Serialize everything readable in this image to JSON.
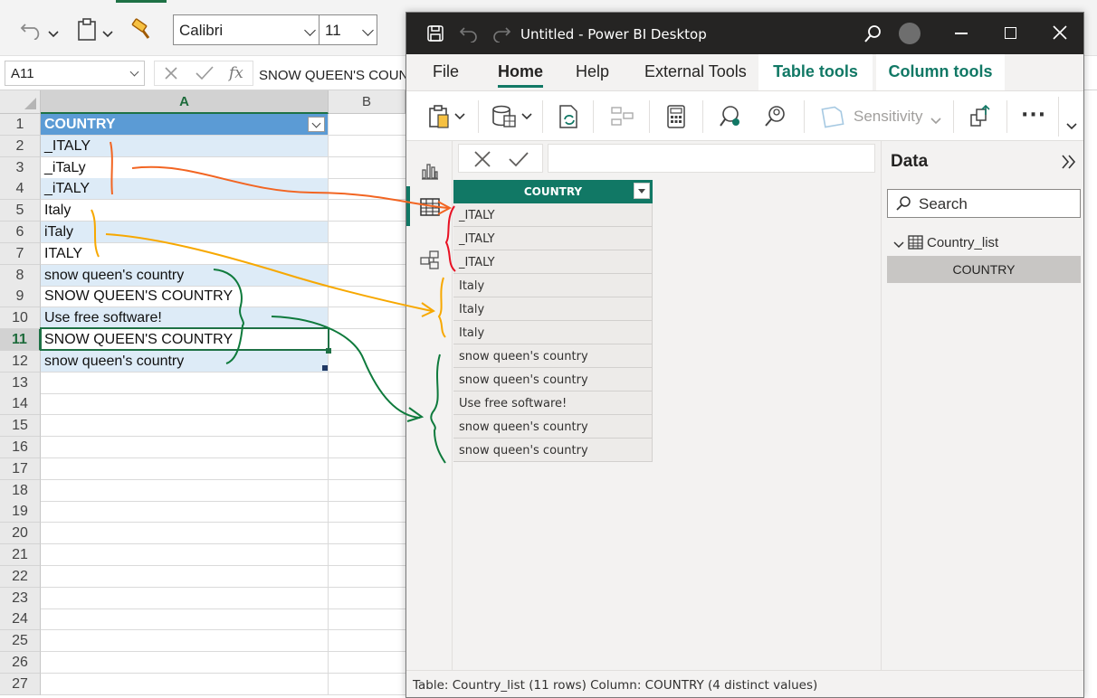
{
  "excel": {
    "font_name": "Calibri",
    "font_size": "11",
    "name_box": "A11",
    "formula": "SNOW QUEEN'S COUNTRY",
    "col_headers": [
      "A",
      "B"
    ],
    "row_numbers": [
      "1",
      "2",
      "3",
      "4",
      "5",
      "6",
      "7",
      "8",
      "9",
      "10",
      "11",
      "12",
      "13",
      "14",
      "15",
      "16",
      "17",
      "18",
      "19",
      "20",
      "21",
      "22",
      "23",
      "24",
      "25",
      "26",
      "27"
    ],
    "header_cell": "COUNTRY",
    "cells": [
      "_ITALY",
      "_iTaLy",
      "_iTALY",
      "Italy",
      "iTaly",
      "ITALY",
      "snow queen's country",
      "SNOW QUEEN'S COUNTRY",
      "Use free software!",
      "SNOW QUEEN'S COUNTRY",
      "snow queen's country"
    ],
    "active_row": "11"
  },
  "powerbi": {
    "window_title": "Untitled - Power BI Desktop",
    "menu": [
      "File",
      "Home",
      "Help",
      "External Tools"
    ],
    "active_menu": "Home",
    "context_tabs": [
      "Table tools",
      "Column tools"
    ],
    "ribbon_sensitivity": "Sensitivity",
    "ribbon_more": "···",
    "table_header": "COUNTRY",
    "rows": [
      "_ITALY",
      "_ITALY",
      "_ITALY",
      "Italy",
      "Italy",
      "Italy",
      "snow queen's country",
      "snow queen's country",
      "Use free software!",
      "snow queen's country",
      "snow queen's country"
    ],
    "data_pane": {
      "title": "Data",
      "search_placeholder": "Search",
      "table_name": "Country_list",
      "field": "COUNTRY"
    },
    "status_bar": "Table: Country_list (11 rows) Column: COUNTRY (4 distinct values)"
  },
  "colors": {
    "excel_green": "#1e7145",
    "table_header_blue": "#5b9bd5",
    "band_blue": "#ddebf7",
    "pbi_teal": "#117865",
    "annot_red": "#e81123",
    "annot_orange": "#f26522",
    "annot_yellow": "#f7a800",
    "annot_green": "#0e7a3c"
  },
  "icons": [
    "undo-icon",
    "clipboard-icon",
    "format-painter-icon",
    "cancel-icon",
    "enter-icon",
    "fx-icon",
    "save-icon",
    "redo-icon",
    "search-icon",
    "avatar",
    "minimize-icon",
    "maximize-icon",
    "close-icon",
    "report-view-icon",
    "table-view-icon",
    "model-view-icon",
    "paste-icon",
    "get-data-icon",
    "refresh-icon",
    "calculator-icon",
    "expand-icon"
  ]
}
